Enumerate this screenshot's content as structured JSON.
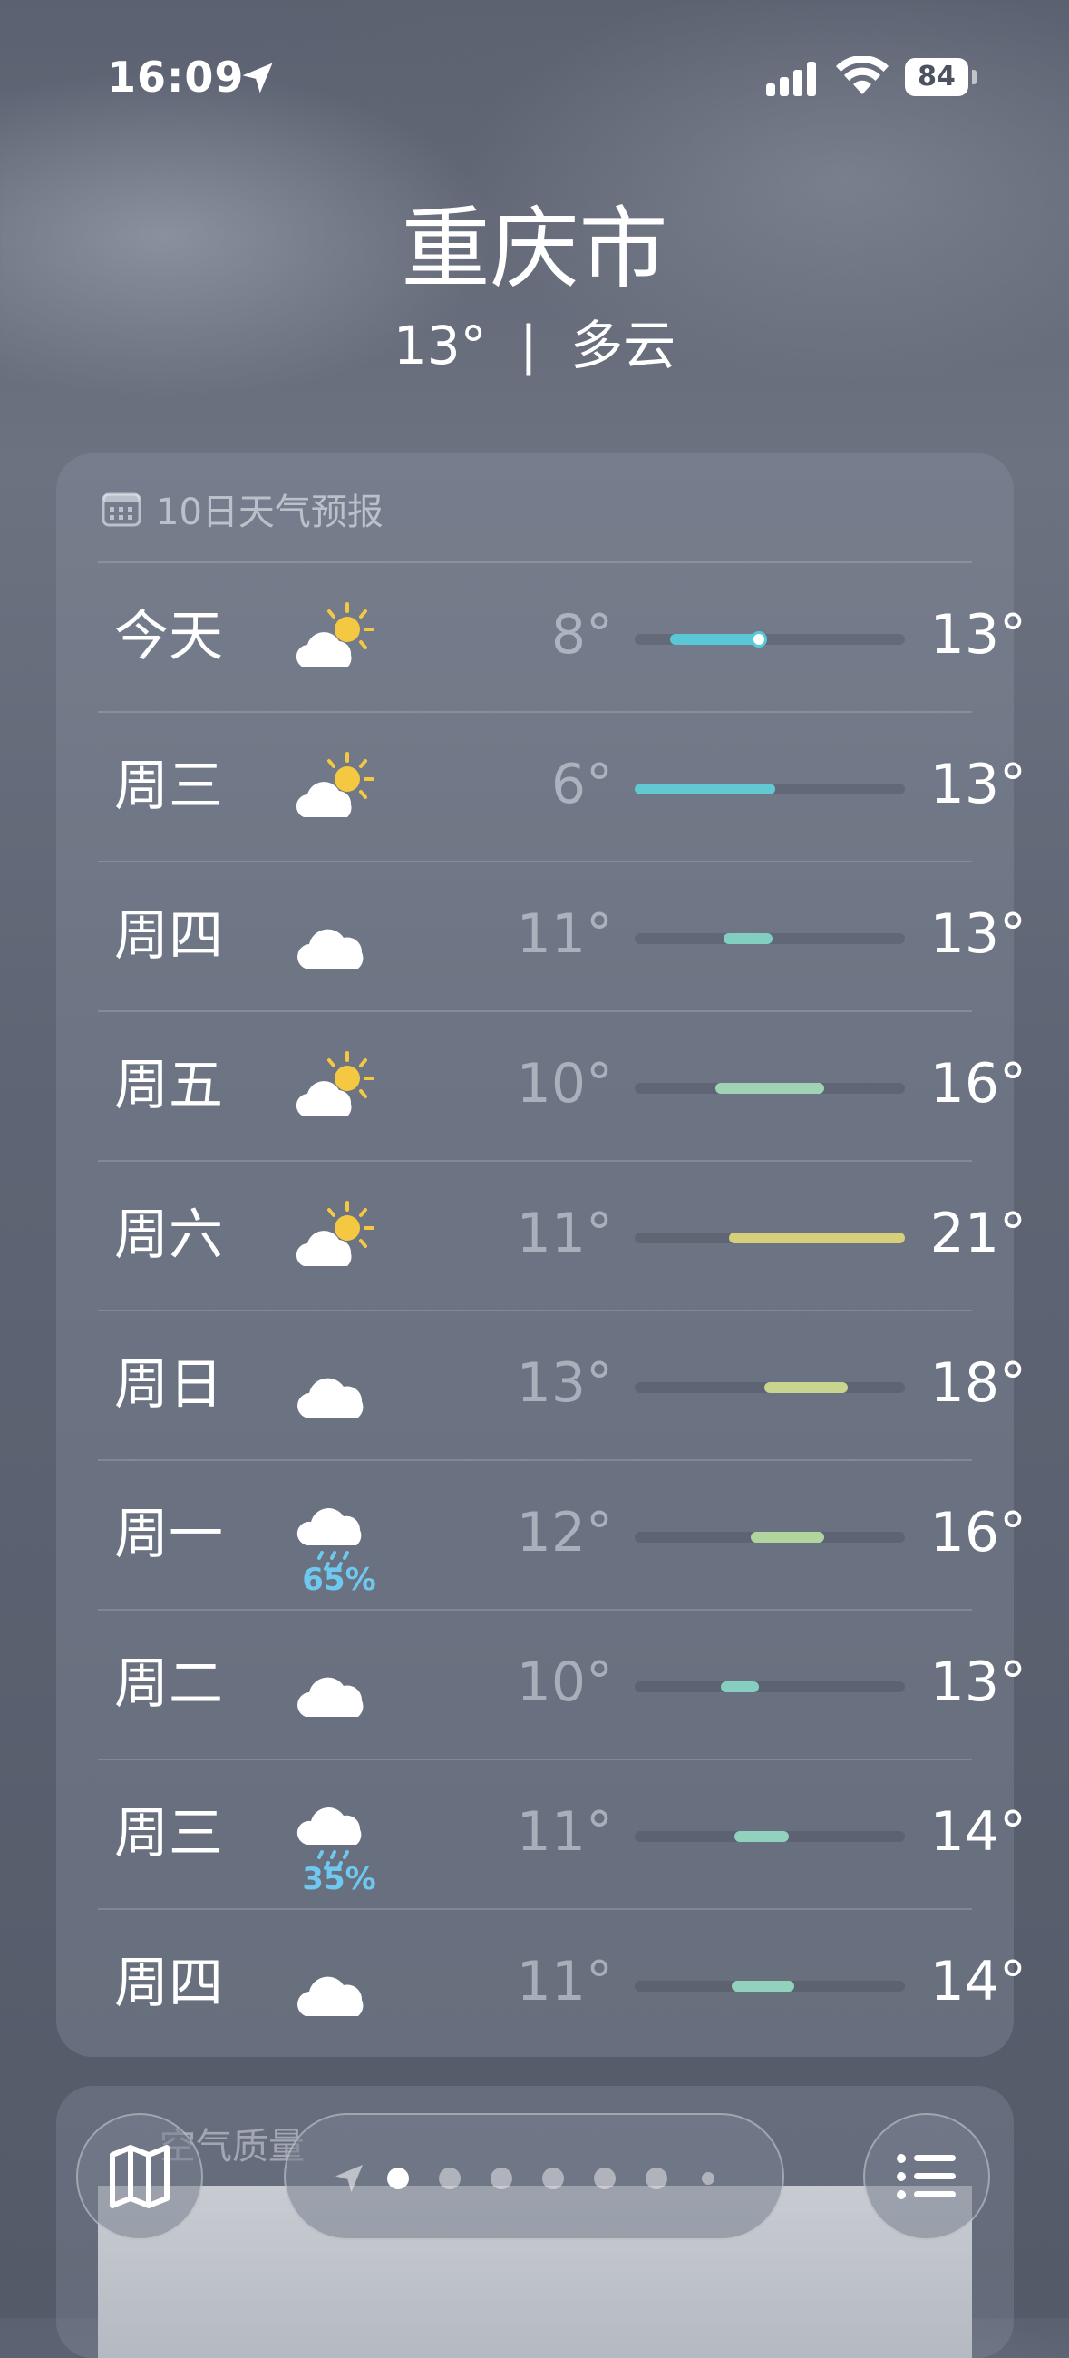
{
  "status_bar": {
    "time": "16:09",
    "battery": "84"
  },
  "location": {
    "city": "重庆市",
    "current_temp": "13°",
    "separator": "|",
    "condition": "多云"
  },
  "forecast": {
    "title": "10日天气预报",
    "days": [
      {
        "day": "今天",
        "icon": "partly-cloudy-sun-icon",
        "low": "8°",
        "high": "13°",
        "range_start": 0.13,
        "range_end": 0.47,
        "fill": "#5ac7d6",
        "current": 0.46
      },
      {
        "day": "周三",
        "icon": "partly-cloudy-sun-icon",
        "low": "6°",
        "high": "13°",
        "range_start": 0.0,
        "range_end": 0.52,
        "fill": "#62c9d3"
      },
      {
        "day": "周四",
        "icon": "cloud-icon",
        "low": "11°",
        "high": "13°",
        "range_start": 0.33,
        "range_end": 0.51,
        "fill": "#82cfc2"
      },
      {
        "day": "周五",
        "icon": "partly-cloudy-sun-icon",
        "low": "10°",
        "high": "16°",
        "range_start": 0.3,
        "range_end": 0.7,
        "fill": "#9fd3b3"
      },
      {
        "day": "周六",
        "icon": "partly-cloudy-sun-icon",
        "low": "11°",
        "high": "21°",
        "range_start": 0.35,
        "range_end": 1.0,
        "fill": "#d8cf7a"
      },
      {
        "day": "周日",
        "icon": "cloud-icon",
        "low": "13°",
        "high": "18°",
        "range_start": 0.48,
        "range_end": 0.79,
        "fill": "#c9d48e"
      },
      {
        "day": "周一",
        "icon": "rain-cloud-icon",
        "pop": "65%",
        "low": "12°",
        "high": "16°",
        "range_start": 0.43,
        "range_end": 0.7,
        "fill": "#b1d59e"
      },
      {
        "day": "周二",
        "icon": "cloud-icon",
        "low": "10°",
        "high": "13°",
        "range_start": 0.32,
        "range_end": 0.46,
        "fill": "#86cfc0"
      },
      {
        "day": "周三",
        "icon": "rain-cloud-icon",
        "pop": "35%",
        "low": "11°",
        "high": "14°",
        "range_start": 0.37,
        "range_end": 0.57,
        "fill": "#92d1bc"
      },
      {
        "day": "周四",
        "icon": "cloud-icon",
        "low": "11°",
        "high": "14°",
        "range_start": 0.36,
        "range_end": 0.59,
        "fill": "#92d1bc"
      }
    ]
  },
  "second_card": {
    "title": "空气质量"
  },
  "toolbar": {
    "map_icon": "map-icon",
    "list_icon": "list-icon",
    "pages": 7,
    "active_page": 0
  }
}
